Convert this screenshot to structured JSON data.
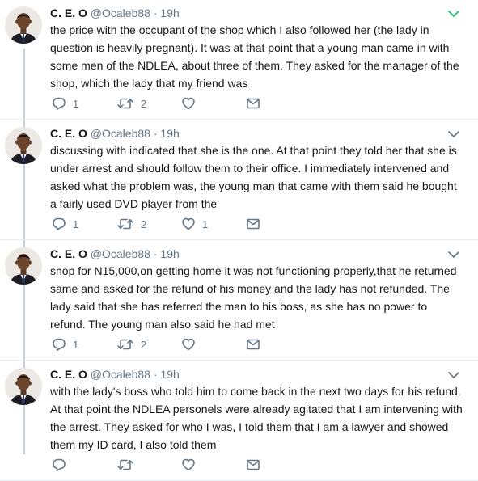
{
  "tweets": [
    {
      "name": "C. E. O",
      "handle": "@Ocaleb88",
      "dot": "·",
      "time": "19h",
      "body": "the price with the occupant of the shop which I also followed her (the lady in question is heavily pregnant). It was at that point that a young man came in with some men of the NDLEA, about three of them. They asked for the manager of the shop, which the lady that my friend was",
      "reply_count": "1",
      "retweet_count": "2",
      "like_count": "",
      "caret_color": "#17bf63"
    },
    {
      "name": "C. E. O",
      "handle": "@Ocaleb88",
      "dot": "·",
      "time": "19h",
      "body": "discussing with indicated that she is the one. At that point they told her that she is under arrest and should follow them to their office. I immediately intervened and asked what the problem was, the young man that came with them said he bought a fairly used DVD player from the",
      "reply_count": "1",
      "retweet_count": "2",
      "like_count": "1",
      "caret_color": "#657786"
    },
    {
      "name": "C. E. O",
      "handle": "@Ocaleb88",
      "dot": "·",
      "time": "19h",
      "body": "shop for N15,000,on getting home it was not functioning properly,that he returned same and asked for the refund of his money and the lady has not refunded. The lady said that she has referred the man to his boss, as she has  no power to refund. The young man also said he had met",
      "reply_count": "1",
      "retweet_count": "2",
      "like_count": "",
      "caret_color": "#657786"
    },
    {
      "name": "C. E. O",
      "handle": "@Ocaleb88",
      "dot": "·",
      "time": "19h",
      "body": "with the lady's boss who told him to come back in the next two days for his refund. At that point the NDLEA personels were already agitated that I am intervening with the arrest. They asked for who I was, I told them that I am a lawyer and showed them my ID card, I also told them",
      "reply_count": "",
      "retweet_count": "",
      "like_count": "",
      "caret_color": "#657786"
    }
  ],
  "icons": {
    "reply": "reply-icon",
    "retweet": "retweet-icon",
    "like": "heart-icon",
    "dm": "envelope-icon",
    "caret": "chevron-down-icon"
  },
  "colors": {
    "accent": "#1da1f2",
    "muted": "#657786",
    "thread_line": "#c4cfd6"
  }
}
